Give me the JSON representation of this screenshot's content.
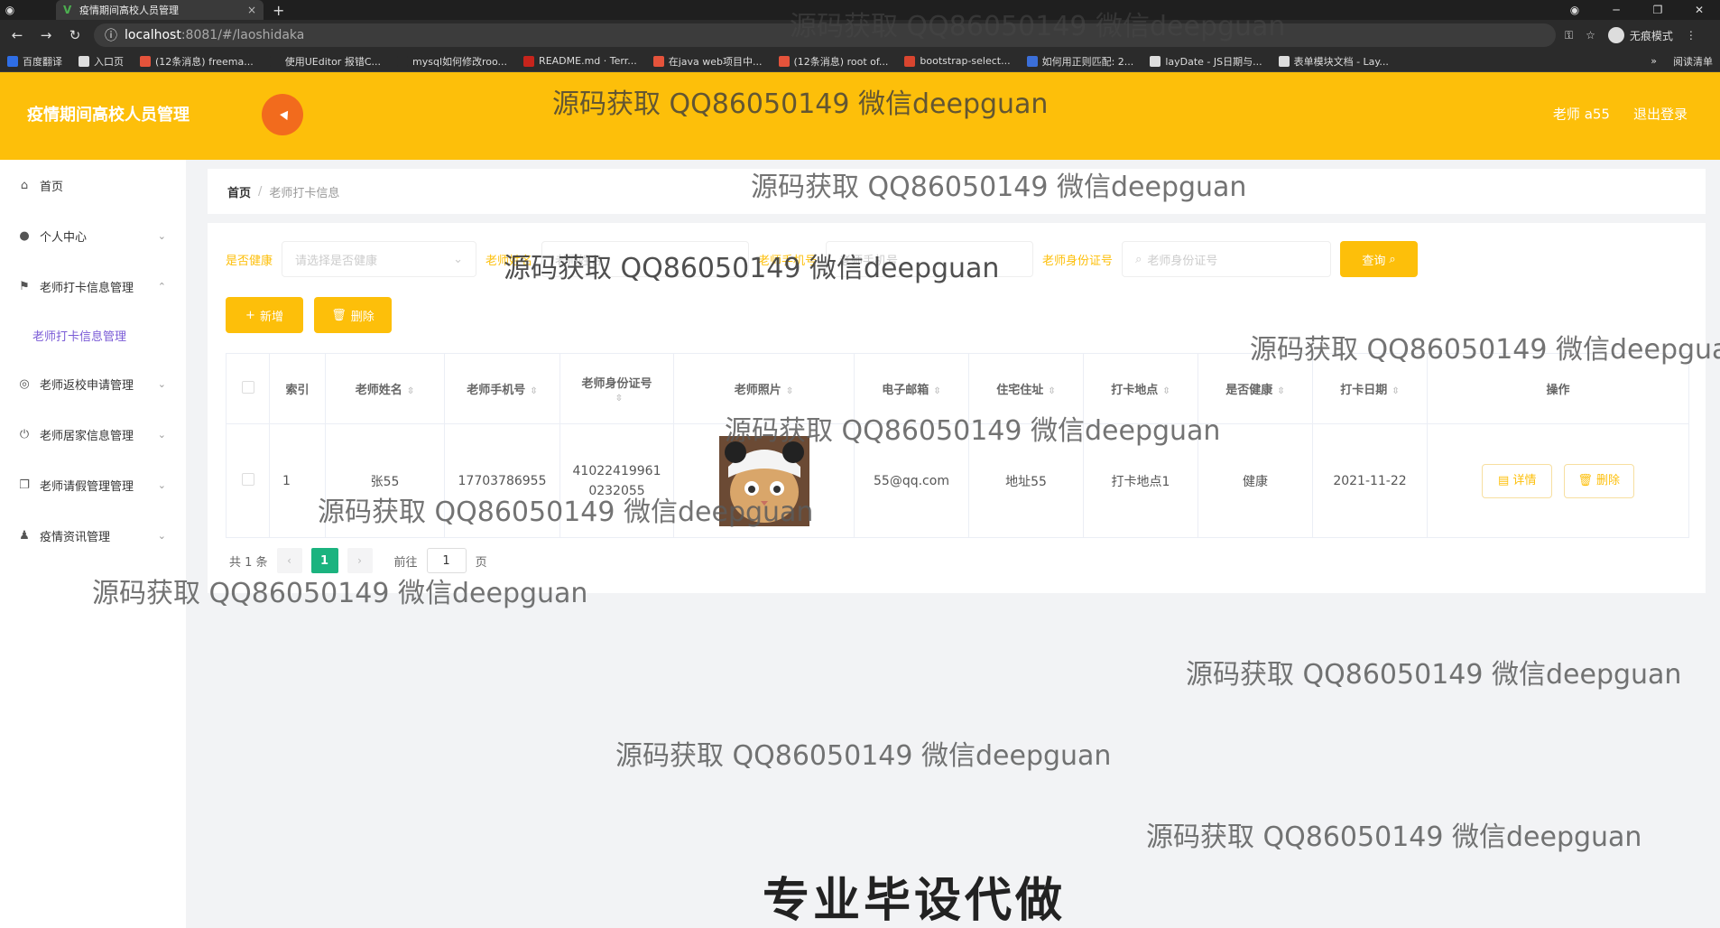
{
  "browser": {
    "tab_title": "疫情期间高校人员管理",
    "tab_close": "×",
    "new_tab": "+",
    "url_host": "localhost",
    "url_path": ":8081/#/laoshidaka",
    "incognito_label": "无痕模式",
    "bookmarks": [
      {
        "label": "百度翻译",
        "color": "#2f6ee6"
      },
      {
        "label": "入口页",
        "color": "#dddddd"
      },
      {
        "label": "(12条消息) freema...",
        "color": "#e5533b"
      },
      {
        "label": "使用UEditor 报错C...",
        "color": "#2b2b2b"
      },
      {
        "label": "mysql如何修改roo...",
        "color": "#2b2b2b"
      },
      {
        "label": "README.md · Terr...",
        "color": "#c7241c"
      },
      {
        "label": "在java web项目中...",
        "color": "#e5533b"
      },
      {
        "label": "(12条消息) root of...",
        "color": "#e5533b"
      },
      {
        "label": "bootstrap-select...",
        "color": "#d9452f"
      },
      {
        "label": "如何用正则匹配: 2...",
        "color": "#3b6fd9"
      },
      {
        "label": "layDate - JS日期与...",
        "color": "#dddddd"
      },
      {
        "label": "表单模块文档 - Lay...",
        "color": "#dddddd"
      }
    ],
    "bookmarks_more": "»",
    "reading_mode": "阅读清单"
  },
  "header": {
    "title": "疫情期间高校人员管理",
    "user": "老师 a55",
    "logout": "退出登录"
  },
  "sidebar": {
    "items": [
      {
        "label": "首页",
        "icon": "home-icon",
        "glyph": "⌂",
        "chevron": ""
      },
      {
        "label": "个人中心",
        "icon": "user-icon",
        "glyph": "●",
        "chevron": "⌄"
      },
      {
        "label": "老师打卡信息管理",
        "icon": "flag-icon",
        "glyph": "⚑",
        "chevron": "⌃"
      },
      {
        "label": "老师打卡信息管理",
        "icon": "",
        "glyph": "",
        "chevron": "",
        "sub": true
      },
      {
        "label": "老师返校申请管理",
        "icon": "globe-icon",
        "glyph": "◎",
        "chevron": "⌄"
      },
      {
        "label": "老师居家信息管理",
        "icon": "power-icon",
        "glyph": "⏻",
        "chevron": "⌄"
      },
      {
        "label": "老师请假管理管理",
        "icon": "copy-icon",
        "glyph": "❐",
        "chevron": "⌄"
      },
      {
        "label": "疫情资讯管理",
        "icon": "person-icon",
        "glyph": "♟",
        "chevron": "⌄"
      }
    ]
  },
  "breadcrumb": {
    "home": "首页",
    "sep": "/",
    "current": "老师打卡信息"
  },
  "filters": {
    "health_label": "是否健康",
    "health_placeholder": "请选择是否健康",
    "name_label": "老师姓名",
    "name_placeholder": "老师姓名",
    "phone_label": "老师手机号",
    "phone_placeholder": "老师手机号",
    "id_label": "老师身份证号",
    "id_placeholder": "老师身份证号",
    "query": "查询"
  },
  "actions": {
    "add": "新增",
    "delete": "删除"
  },
  "table": {
    "headers": [
      "索引",
      "老师姓名",
      "老师手机号",
      "老师身份证号",
      "老师照片",
      "电子邮箱",
      "住宅住址",
      "打卡地点",
      "是否健康",
      "打卡日期",
      "操作"
    ],
    "rows": [
      {
        "index": "1",
        "name": "张55",
        "phone": "17703786955",
        "id": "410224199610232055",
        "email": "55@qq.com",
        "address": "地址55",
        "checkin_place": "打卡地点1",
        "healthy": "健康",
        "date": "2021-11-22",
        "detail": "详情",
        "remove": "删除"
      }
    ]
  },
  "pagination": {
    "total": "共 1 条",
    "page": "1",
    "goto": "前往",
    "goto_value": "1",
    "page_unit": "页"
  },
  "watermark": "源码获取 QQ86050149 微信deepguan",
  "banner": "专业毕设代做"
}
